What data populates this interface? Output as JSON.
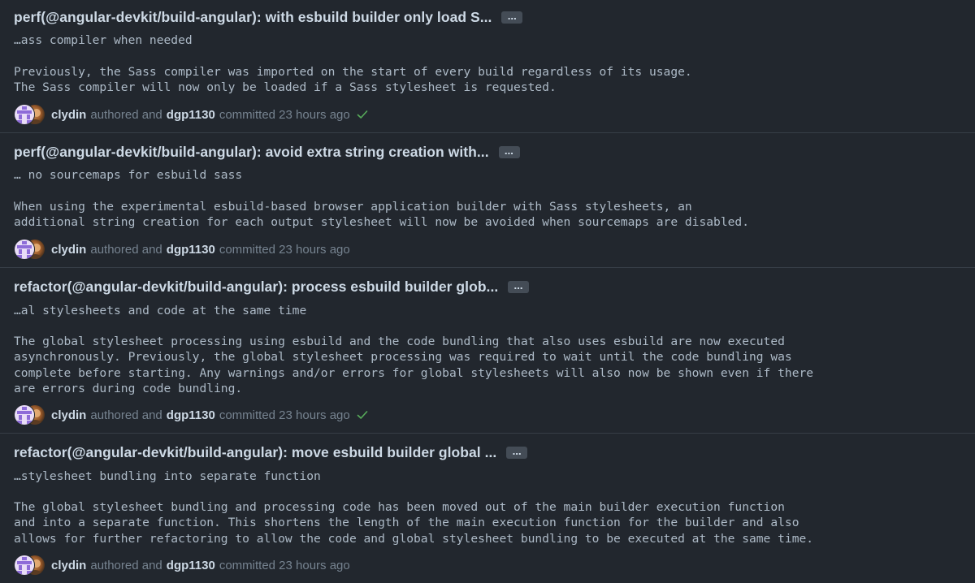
{
  "commits": [
    {
      "title": "perf(@angular-devkit/build-angular): with esbuild builder only load S...",
      "expand_label": "…",
      "body": [
        "…ass compiler when needed",
        "",
        "Previously, the Sass compiler was imported on the start of every build regardless of its usage.",
        "The Sass compiler will now only be loaded if a Sass stylesheet is requested."
      ],
      "author": "clydin",
      "authored_text": "authored and",
      "committer": "dgp1130",
      "committed_text": "committed 23 hours ago",
      "status": "success"
    },
    {
      "title": "perf(@angular-devkit/build-angular): avoid extra string creation with...",
      "expand_label": "…",
      "body": [
        "… no sourcemaps for esbuild sass",
        "",
        "When using the experimental esbuild-based browser application builder with Sass stylesheets, an",
        "additional string creation for each output stylesheet will now be avoided when sourcemaps are disabled."
      ],
      "author": "clydin",
      "authored_text": "authored and",
      "committer": "dgp1130",
      "committed_text": "committed 23 hours ago",
      "status": "none"
    },
    {
      "title": "refactor(@angular-devkit/build-angular): process esbuild builder glob...",
      "expand_label": "…",
      "body": [
        "…al stylesheets and code at the same time",
        "",
        "The global stylesheet processing using esbuild and the code bundling that also uses esbuild are now executed",
        "asynchronously. Previously, the global stylesheet processing was required to wait until the code bundling was",
        "complete before starting. Any warnings and/or errors for global stylesheets will also now be shown even if there",
        "are errors during code bundling."
      ],
      "author": "clydin",
      "authored_text": "authored and",
      "committer": "dgp1130",
      "committed_text": "committed 23 hours ago",
      "status": "success"
    },
    {
      "title": "refactor(@angular-devkit/build-angular): move esbuild builder global ...",
      "expand_label": "…",
      "body": [
        "…stylesheet bundling into separate function",
        "",
        "The global stylesheet bundling and processing code has been moved out of the main builder execution function",
        "and into a separate function. This shortens the length of the main execution function for the builder and also",
        "allows for further refactoring to allow the code and global stylesheet bundling to be executed at the same time."
      ],
      "author": "clydin",
      "authored_text": "authored and",
      "committer": "dgp1130",
      "committed_text": "committed 23 hours ago",
      "status": "none"
    }
  ],
  "colors": {
    "background": "#22272e",
    "title": "#cdd9e5",
    "body": "#adbac7",
    "muted": "#768390",
    "success_check": "#57ab5a",
    "divider": "#373e47"
  },
  "icons": {
    "avatar_clydin": "identicon-avatar",
    "avatar_dgp1130": "photo-avatar",
    "status_success": "check-icon"
  }
}
